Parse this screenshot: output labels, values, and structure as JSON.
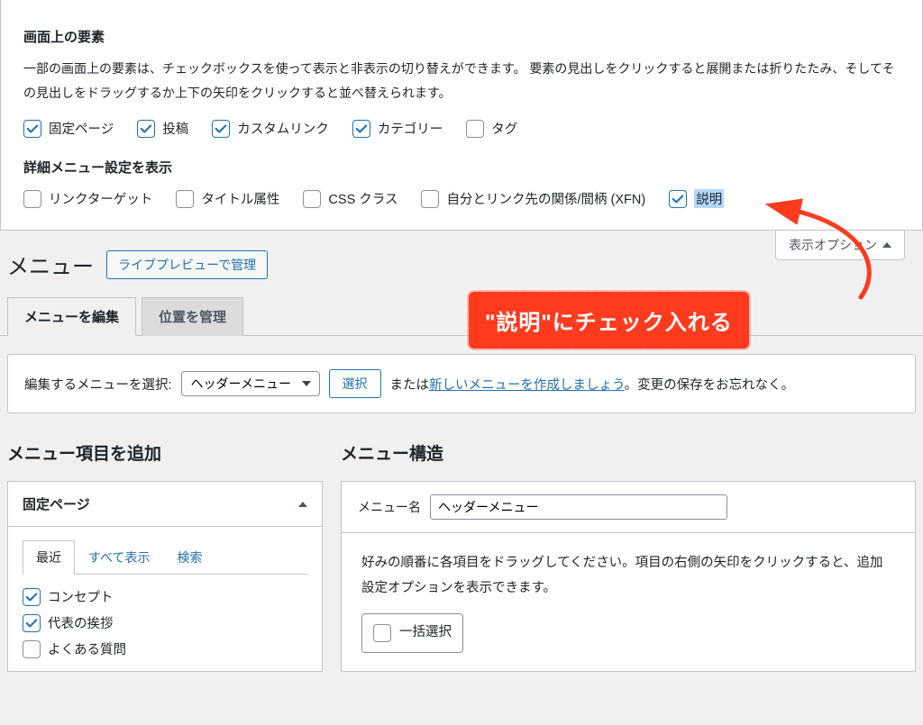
{
  "screen_options": {
    "heading_elements": "画面上の要素",
    "description": "一部の画面上の要素は、チェックボックスを使って表示と非表示の切り替えができます。 要素の見出しをクリックすると展開または折りたたみ、そしてその見出しをドラッグするか上下の矢印をクリックすると並べ替えられます。",
    "boxes": [
      {
        "label": "固定ページ",
        "checked": true
      },
      {
        "label": "投稿",
        "checked": true
      },
      {
        "label": "カスタムリンク",
        "checked": true
      },
      {
        "label": "カテゴリー",
        "checked": true
      },
      {
        "label": "タグ",
        "checked": false
      }
    ],
    "heading_advanced": "詳細メニュー設定を表示",
    "advanced": [
      {
        "label": "リンクターゲット",
        "checked": false
      },
      {
        "label": "タイトル属性",
        "checked": false
      },
      {
        "label": "CSS クラス",
        "checked": false
      },
      {
        "label": "自分とリンク先の関係/間柄 (XFN)",
        "checked": false
      },
      {
        "label": "説明",
        "checked": true,
        "highlight": true
      }
    ],
    "toggle_label": "表示オプション"
  },
  "page": {
    "title": "メニュー",
    "live_preview": "ライブプレビューで管理"
  },
  "tabs": {
    "edit": "メニューを編集",
    "locations": "位置を管理"
  },
  "selector": {
    "label": "編集するメニューを選択:",
    "value": "ヘッダーメニュー",
    "button": "選択",
    "or": "または",
    "create_link": "新しいメニューを作成しましょう",
    "tail": "。変更の保存をお忘れなく。"
  },
  "columns_headings": {
    "add": "メニュー項目を追加",
    "structure": "メニュー構造"
  },
  "postbox": {
    "title": "固定ページ",
    "tabs": {
      "recent": "最近",
      "all": "すべて表示",
      "search": "検索"
    },
    "items": [
      {
        "label": "コンセプト",
        "checked": true
      },
      {
        "label": "代表の挨拶",
        "checked": true
      },
      {
        "label": "よくある質問",
        "checked": false
      }
    ]
  },
  "structure": {
    "name_label": "メニュー名",
    "name_value": "ヘッダーメニュー",
    "help": "好みの順番に各項目をドラッグしてください。項目の右側の矢印をクリックすると、追加設定オプションを表示できます。",
    "bulk_label": "一括選択"
  },
  "annotation": {
    "text": "\"説明\"にチェック入れる"
  }
}
